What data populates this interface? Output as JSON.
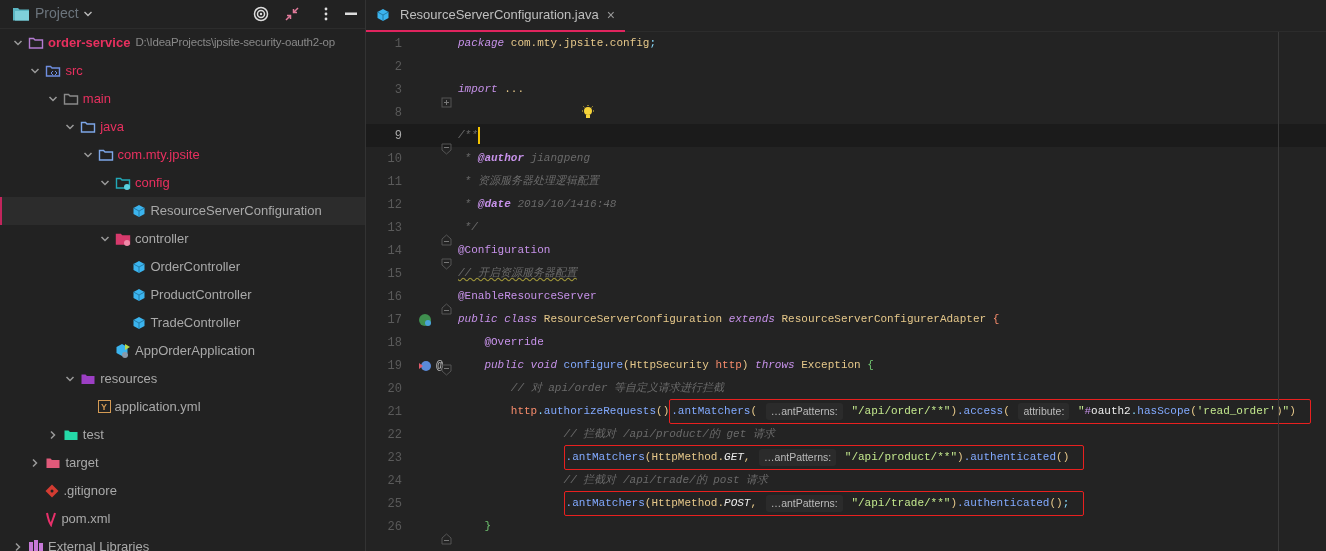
{
  "sidebar": {
    "title": "Project",
    "tree": [
      {
        "label": "order-service",
        "path": "D:\\IdeaProjects\\jpsite-security-oauth2-op",
        "kind": "module",
        "modified": true,
        "expanded": true,
        "selected": false,
        "children": [
          {
            "label": "src",
            "kind": "source",
            "modified": true,
            "expanded": true,
            "selected": false,
            "children": [
              {
                "label": "main",
                "kind": "folder",
                "modified": true,
                "expanded": true,
                "selected": false,
                "children": [
                  {
                    "label": "java",
                    "kind": "package",
                    "modified": true,
                    "expanded": true,
                    "selected": false,
                    "children": [
                      {
                        "label": "com.mty.jpsite",
                        "kind": "package",
                        "modified": true,
                        "expanded": true,
                        "selected": false,
                        "children": [
                          {
                            "label": "config",
                            "kind": "config",
                            "modified": true,
                            "expanded": true,
                            "selected": false,
                            "children": [
                              {
                                "label": "ResourceServerConfiguration",
                                "kind": "class",
                                "modified": false,
                                "selected": true
                              }
                            ]
                          },
                          {
                            "label": "controller",
                            "kind": "controller",
                            "modified": false,
                            "expanded": true,
                            "selected": false,
                            "children": [
                              {
                                "label": "OrderController",
                                "kind": "class",
                                "modified": false,
                                "selected": false
                              },
                              {
                                "label": "ProductController",
                                "kind": "class",
                                "modified": false,
                                "selected": false
                              },
                              {
                                "label": "TradeController",
                                "kind": "class",
                                "modified": false,
                                "selected": false
                              }
                            ]
                          },
                          {
                            "label": "AppOrderApplication",
                            "kind": "app",
                            "modified": false,
                            "selected": false
                          }
                        ]
                      }
                    ]
                  },
                  {
                    "label": "resources",
                    "kind": "resources",
                    "modified": false,
                    "expanded": true,
                    "selected": false,
                    "children": [
                      {
                        "label": "application.yml",
                        "kind": "yaml",
                        "icon_text": "Y",
                        "modified": false,
                        "selected": false
                      }
                    ]
                  }
                ]
              },
              {
                "label": "test",
                "kind": "test",
                "modified": false,
                "expanded": false,
                "selected": false
              }
            ]
          },
          {
            "label": "target",
            "kind": "target",
            "modified": false,
            "expanded": false,
            "selected": false
          },
          {
            "label": ".gitignore",
            "kind": "gitignore",
            "modified": false,
            "selected": false
          },
          {
            "label": "pom.xml",
            "kind": "maven",
            "modified": false,
            "selected": false
          }
        ]
      },
      {
        "label": "External Libraries",
        "kind": "library",
        "modified": false,
        "expanded": false,
        "selected": false
      }
    ]
  },
  "editor": {
    "tabs": [
      {
        "label": "ResourceServerConfiguration.java",
        "close": "×",
        "selected": true
      }
    ],
    "lines": [
      {
        "number": "1",
        "current": false,
        "tokens": [
          {
            "kind": "kw",
            "text": "package"
          },
          {
            "kind": "type",
            "text": " com.mty.jpsite.config"
          },
          {
            "kind": "punct",
            "text": ";"
          }
        ]
      },
      {
        "number": "2",
        "current": false
      },
      {
        "number": "3",
        "current": false,
        "gutter": [
          {
            "kind": "fold-collapsed"
          }
        ],
        "tokens": [
          {
            "kind": "kw",
            "text": "import"
          },
          {
            "kind": "type",
            "text": " ..."
          }
        ]
      },
      {
        "number": "8",
        "current": false,
        "bulb": true
      },
      {
        "number": "9",
        "current": true,
        "gutter": [
          {
            "kind": "fold-start"
          }
        ],
        "tokens": [
          {
            "kind": "comment",
            "text": "/**"
          }
        ]
      },
      {
        "number": "10",
        "current": false,
        "tokens": [
          {
            "kind": "comment",
            "text": " * "
          },
          {
            "kind": "doctag",
            "text": "@author"
          },
          {
            "kind": "comment",
            "text": " jiangpeng"
          }
        ]
      },
      {
        "number": "11",
        "current": false,
        "tokens": [
          {
            "kind": "comment",
            "text": " * 资源服务器处理逻辑配置"
          }
        ]
      },
      {
        "number": "12",
        "current": false,
        "tokens": [
          {
            "kind": "comment",
            "text": " * "
          },
          {
            "kind": "doctag",
            "text": "@date"
          },
          {
            "kind": "comment",
            "text": " 2019/10/1416:48"
          }
        ]
      },
      {
        "number": "13",
        "current": false,
        "gutter": [
          {
            "kind": "fold-end"
          }
        ],
        "tokens": [
          {
            "kind": "comment",
            "text": " */"
          }
        ]
      },
      {
        "number": "14",
        "current": false,
        "gutter": [
          {
            "kind": "fold-start"
          }
        ],
        "tokens": [
          {
            "kind": "annot",
            "text": "@Configuration"
          }
        ]
      },
      {
        "number": "15",
        "current": false,
        "tokens": [
          {
            "kind": "typo",
            "text": "// 开启资源服务器配置"
          }
        ]
      },
      {
        "number": "16",
        "current": false,
        "gutter": [
          {
            "kind": "fold-end"
          }
        ],
        "tokens": [
          {
            "kind": "annot",
            "text": "@EnableResourceServer"
          }
        ]
      },
      {
        "number": "17",
        "current": false,
        "gutter": [
          {
            "kind": "implemented"
          }
        ],
        "tokens": [
          {
            "kind": "kw",
            "text": "public class"
          },
          {
            "kind": "type",
            "text": " ResourceServerConfiguration "
          },
          {
            "kind": "kw",
            "text": "extends"
          },
          {
            "kind": "type",
            "text": " ResourceServerConfigurerAdapter "
          },
          {
            "kind": "param",
            "text": "{"
          }
        ],
        "children": [
          {
            "number": "18",
            "current": false,
            "tokens": [
              {
                "kind": "annot",
                "text": "@Override"
              }
            ]
          },
          {
            "number": "19",
            "current": false,
            "gutter": [
              {
                "kind": "overrides"
              },
              {
                "kind": "annotated",
                "text": "@"
              },
              {
                "kind": "fold-start"
              }
            ],
            "tokens": [
              {
                "kind": "kw",
                "text": "public void"
              },
              {
                "kind": "method",
                "text": " configure"
              },
              {
                "kind": "type",
                "text": "(HttpSecurity "
              },
              {
                "kind": "param",
                "text": "http"
              },
              {
                "kind": "type",
                "text": ") "
              },
              {
                "kind": "kw",
                "text": "throws"
              },
              {
                "kind": "type",
                "text": " Exception "
              },
              {
                "kind": "brace",
                "text": "{"
              }
            ],
            "children": [
              {
                "number": "20",
                "current": false,
                "tokens": [
                  {
                    "kind": "comment",
                    "text": "// 对 api/order 等自定义请求进行拦截"
                  }
                ]
              },
              {
                "number": "21",
                "current": false,
                "tokens": [
                  {
                    "kind": "param",
                    "text": "http"
                  },
                  {
                    "kind": "punct",
                    "text": "."
                  },
                  {
                    "kind": "method",
                    "text": "authorizeRequests"
                  },
                  {
                    "kind": "type",
                    "text": "()"
                  }
                ],
                "highlight": [
                  {
                    "kind": "method",
                    "text": ".antMatchers"
                  },
                  {
                    "kind": "type",
                    "text": "( "
                  },
                  {
                    "kind": "hint",
                    "text": "…antPatterns:"
                  },
                  {
                    "kind": "string",
                    "text": " \"/api/order/**\""
                  },
                  {
                    "kind": "type",
                    "text": ")"
                  },
                  {
                    "kind": "method",
                    "text": ".access"
                  },
                  {
                    "kind": "type",
                    "text": "( "
                  },
                  {
                    "kind": "hint",
                    "text": "attribute:"
                  },
                  {
                    "kind": "string",
                    "text": " \""
                  },
                  {
                    "kind": "annot",
                    "text": "#"
                  },
                  {
                    "kind": "plain",
                    "text": "oauth2"
                  },
                  {
                    "kind": "punct",
                    "text": "."
                  },
                  {
                    "kind": "method",
                    "text": "hasScope"
                  },
                  {
                    "kind": "type",
                    "text": "("
                  },
                  {
                    "kind": "string",
                    "text": "'read_order'"
                  },
                  {
                    "kind": "type",
                    "text": ")"
                  },
                  {
                    "kind": "string",
                    "text": "\""
                  },
                  {
                    "kind": "type",
                    "text": ")"
                  }
                ],
                "children": [
                  {
                    "number": "22",
                    "current": false,
                    "tokens": [
                      {
                        "kind": "comment",
                        "text": "// 拦截对 /api/product/的 get 请求"
                      }
                    ]
                  },
                  {
                    "number": "23",
                    "current": false,
                    "highlight": [
                      {
                        "kind": "method",
                        "text": ".antMatchers"
                      },
                      {
                        "kind": "type",
                        "text": "(HttpMethod."
                      },
                      {
                        "kind": "field",
                        "text": "GET"
                      },
                      {
                        "kind": "type",
                        "text": ", "
                      },
                      {
                        "kind": "hint",
                        "text": "…antPatterns:"
                      },
                      {
                        "kind": "string",
                        "text": " \"/api/product/**\""
                      },
                      {
                        "kind": "type",
                        "text": ")"
                      },
                      {
                        "kind": "method",
                        "text": ".authenticated"
                      },
                      {
                        "kind": "type",
                        "text": "()"
                      }
                    ]
                  },
                  {
                    "number": "24",
                    "current": false,
                    "tokens": [
                      {
                        "kind": "comment",
                        "text": "// 拦截对 /api/trade/的 post 请求"
                      }
                    ]
                  },
                  {
                    "number": "25",
                    "current": false,
                    "highlight": [
                      {
                        "kind": "method",
                        "text": ".antMatchers"
                      },
                      {
                        "kind": "type",
                        "text": "(HttpMethod."
                      },
                      {
                        "kind": "field",
                        "text": "POST"
                      },
                      {
                        "kind": "type",
                        "text": ", "
                      },
                      {
                        "kind": "hint",
                        "text": "…antPatterns:"
                      },
                      {
                        "kind": "string",
                        "text": " \"/api/trade/**\""
                      },
                      {
                        "kind": "type",
                        "text": ")"
                      },
                      {
                        "kind": "method",
                        "text": ".authenticated"
                      },
                      {
                        "kind": "type",
                        "text": "()"
                      },
                      {
                        "kind": "punct",
                        "text": ";"
                      }
                    ]
                  }
                ]
              }
            ]
          },
          {
            "number": "26",
            "current": false,
            "gutter": [
              {
                "kind": "fold-end"
              }
            ],
            "tokens": [
              {
                "kind": "brace",
                "text": "}"
              }
            ]
          }
        ]
      }
    ]
  }
}
